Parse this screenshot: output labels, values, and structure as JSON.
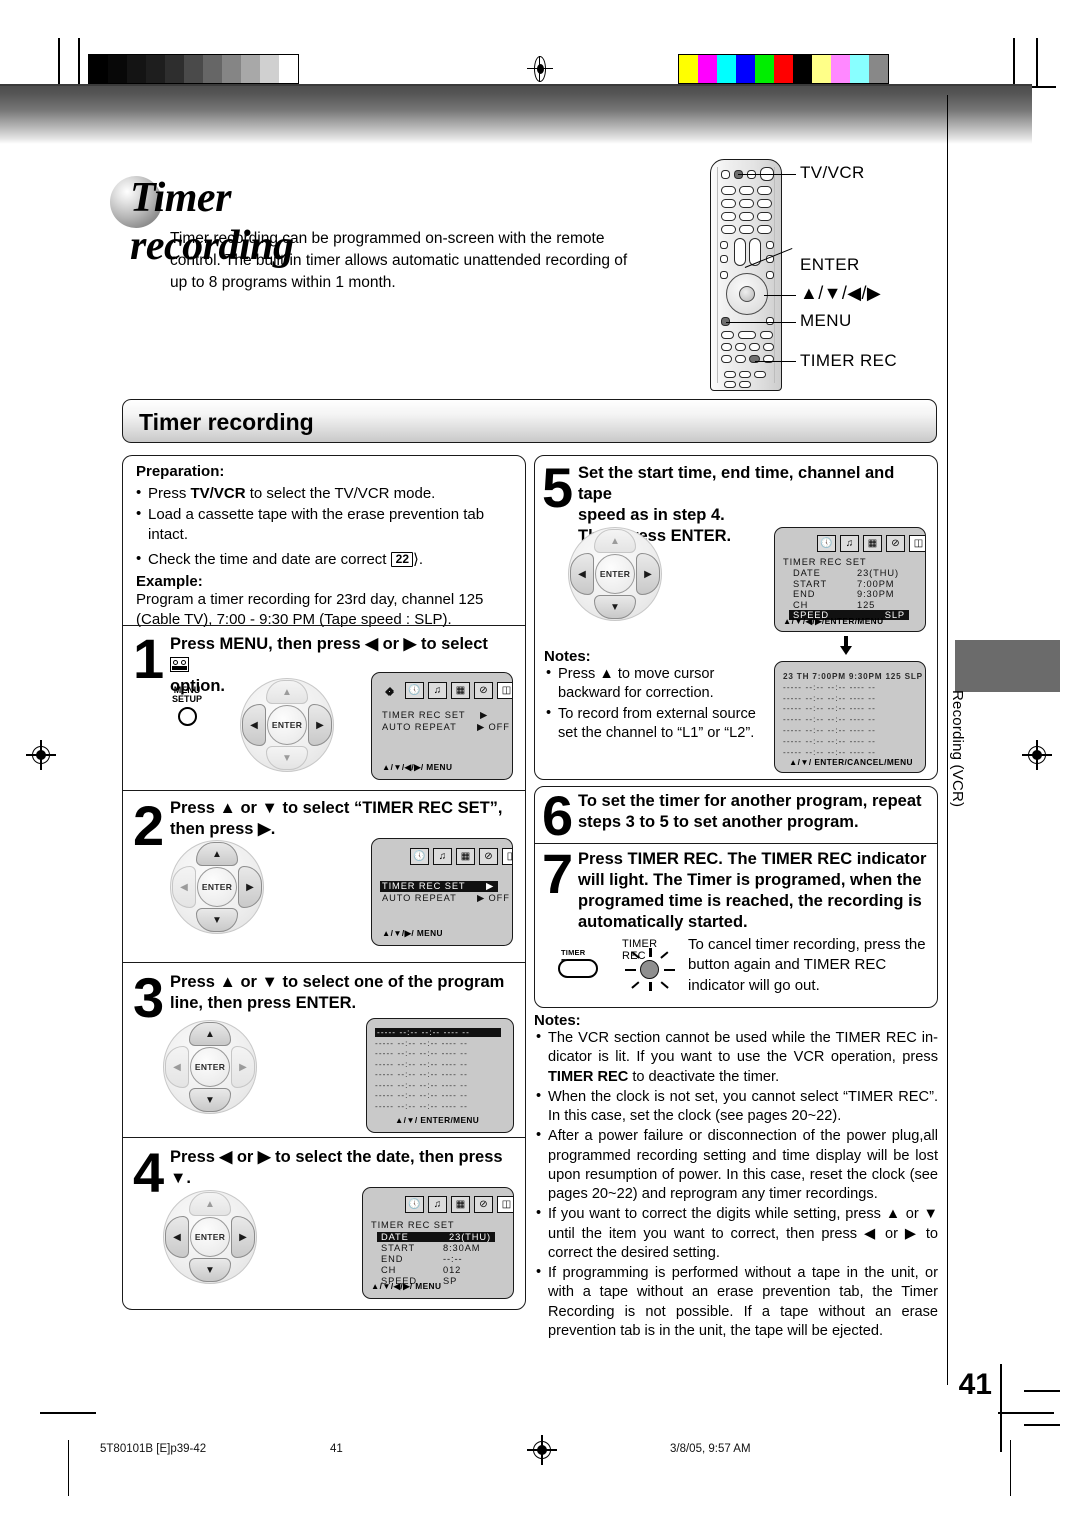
{
  "document": {
    "main_title": "Timer recording",
    "intro": "Timer recording can be programmed on-screen with the remote control. The built-in timer allows automatic unattended recording of up to 8 programs within 1 month.",
    "section_title": "Timer recording",
    "side_tab_label": "Recording (VCR)",
    "page_number": "41"
  },
  "remote_callouts": {
    "tv_vcr": "TV/VCR",
    "enter": "ENTER",
    "arrows": "▲/▼/◀/▶",
    "menu": "MENU",
    "timer_rec": "TIMER REC"
  },
  "preparation": {
    "title": "Preparation:",
    "items": [
      "Press TV/VCR to select the TV/VCR mode.",
      "Load a cassette tape with the erase prevention tab intact.",
      "Check the time and date are correct"
    ],
    "page_ref": "22",
    "example_title": "Example:",
    "example_text": "Program a timer recording for 23rd day, channel 125 (Cable TV), 7:00 - 9:30 PM (Tape speed : SLP)."
  },
  "steps": [
    {
      "num": "1",
      "text": "Press MENU, then press ◀ or ▶ to select ⌗ option.",
      "text_a": "Press MENU, then press ◀ or ▶ to select",
      "text_b": "option.",
      "menu_button_label_1": "MENU",
      "menu_button_label_2": "SETUP"
    },
    {
      "num": "2",
      "text": "Press ▲ or ▼ to select “TIMER REC SET”, then press ▶."
    },
    {
      "num": "3",
      "text": "Press ▲ or ▼ to select one of the program line, then press ENTER."
    },
    {
      "num": "4",
      "text": "Press ◀ or ▶ to select the date, then press ▼."
    },
    {
      "num": "5",
      "line1": "Set the start time, end time, channel and tape",
      "line2": "speed as in step 4.",
      "line3": "Then press ENTER."
    },
    {
      "num": "6",
      "text": "To set the timer for another program, repeat steps 3 to 5 to set another program."
    },
    {
      "num": "7",
      "text": "Press TIMER REC. The TIMER REC indicator will light. The Timer is programed, when the programed time is reached, the recording is automatically started."
    }
  ],
  "osd_menu": {
    "row1_label": "TIMER REC SET",
    "row1_value": "▶",
    "row2_label": "AUTO REPEAT",
    "row2_value": "▶ OFF",
    "footer_1": "▲/▼/◀/▶/ MENU",
    "footer_2": "▲/▼/▶/ MENU",
    "footer_3": "▲/▼/ ENTER/MENU",
    "footer_4": "▲/▼/◀/▶/ MENU",
    "footer_5": "▲/▼/◀/▶/ENTER/MENU",
    "footer_6": "▲/▼/ ENTER/CANCEL/MENU"
  },
  "osd_timer_set_step4": {
    "title": "TIMER  REC  SET",
    "rows": [
      {
        "label": "DATE",
        "value": "23(THU)",
        "highlight": true
      },
      {
        "label": "START",
        "value": "8:30AM",
        "highlight": false
      },
      {
        "label": "END",
        "value": "--:--",
        "highlight": false
      },
      {
        "label": "CH",
        "value": "012",
        "highlight": false
      },
      {
        "label": "SPEED",
        "value": "SP",
        "highlight": false
      }
    ]
  },
  "osd_timer_set_step5": {
    "title": "TIMER  REC  SET",
    "rows": [
      {
        "label": "DATE",
        "value": "23(THU)",
        "highlight": false
      },
      {
        "label": "START",
        "value": "7:00PM",
        "highlight": false
      },
      {
        "label": "END",
        "value": "9:30PM",
        "highlight": false
      },
      {
        "label": "CH",
        "value": "125",
        "highlight": false
      },
      {
        "label": "SPEED",
        "value": "SLP",
        "highlight": true
      }
    ]
  },
  "osd_program_list_empty": {
    "rows": [
      "-----  --:--    --:--    ----   --",
      "-----  --:--    --:--    ----   --",
      "-----  --:--    --:--    ----   --",
      "-----  --:--    --:--    ----   --",
      "-----  --:--    --:--    ----   --",
      "-----  --:--    --:--    ----   --",
      "-----  --:--    --:--    ----   --",
      "-----  --:--    --:--    ----   --"
    ],
    "highlight_index": 0
  },
  "osd_program_list_filled": {
    "rows": [
      "23 TH  7:00PM  9:30PM 125  SLP",
      "-----  --:--    --:--    ----   --",
      "-----  --:--    --:--    ----   --",
      "-----  --:--    --:--    ----   --",
      "-----  --:--    --:--    ----   --",
      "-----  --:--    --:--    ----   --",
      "-----  --:--    --:--    ----   --",
      "-----  --:--    --:--    ----   --"
    ]
  },
  "notes_step5": {
    "title": "Notes:",
    "items": [
      "Press ▲ to move cursor backward for correction.",
      "To record from external source set the channel to “L1” or “L2”."
    ]
  },
  "timer_rec_cancel": {
    "button_label": "TIMER REC",
    "indicator_label": "TIMER REC",
    "text": "To cancel timer recording, press the button again and TIMER REC indicator will go out."
  },
  "notes_bottom": {
    "title": "Notes:",
    "items": [
      "The VCR section cannot be used while the TIMER REC indicator is lit. If you want to use the VCR operation, press TIMER REC to deactivate the timer.",
      "When the clock is not set, you cannot select “TIMER REC”. In this case, set the clock (see pages 20~22).",
      "After a power failure or disconnection of the power plug,all programmed recording setting and time display will be  lost upon resumption of power. In this case, reset the clock (see pages 20~22) and reprogram any timer recordings.",
      "If you want to correct the digits while setting, press ▲ or ▼ until the item you want to correct, then press ◀ or ▶ to correct the desired setting.",
      "If programming is performed without a tape in the unit, or with a tape without an erase prevention tab, the Timer Recording is not possible. If a tape without an erase prevention tab is in the unit, the tape will be ejected."
    ]
  },
  "footer": {
    "left": "5T80101B [E]p39-42",
    "center": "41",
    "right": "3/8/05, 9:57 AM"
  },
  "colors": {
    "grayscale_bar": [
      "#000000",
      "#080808",
      "#141414",
      "#1e1e1e",
      "#2e2e2e",
      "#4a4a4a",
      "#666666",
      "#858585",
      "#a8a8a8",
      "#d0d0d0",
      "#ffffff"
    ],
    "color_bar": [
      "#ffff00",
      "#ff00ff",
      "#00ffff",
      "#0000ff",
      "#00ee00",
      "#ff0000",
      "#000000",
      "#ffff88",
      "#ff88ff",
      "#88ffff",
      "#888888"
    ],
    "led_color": "#8f8f8f",
    "osd_bg": "#c9c9c9",
    "side_tab_bg": "#6b6b6b"
  }
}
